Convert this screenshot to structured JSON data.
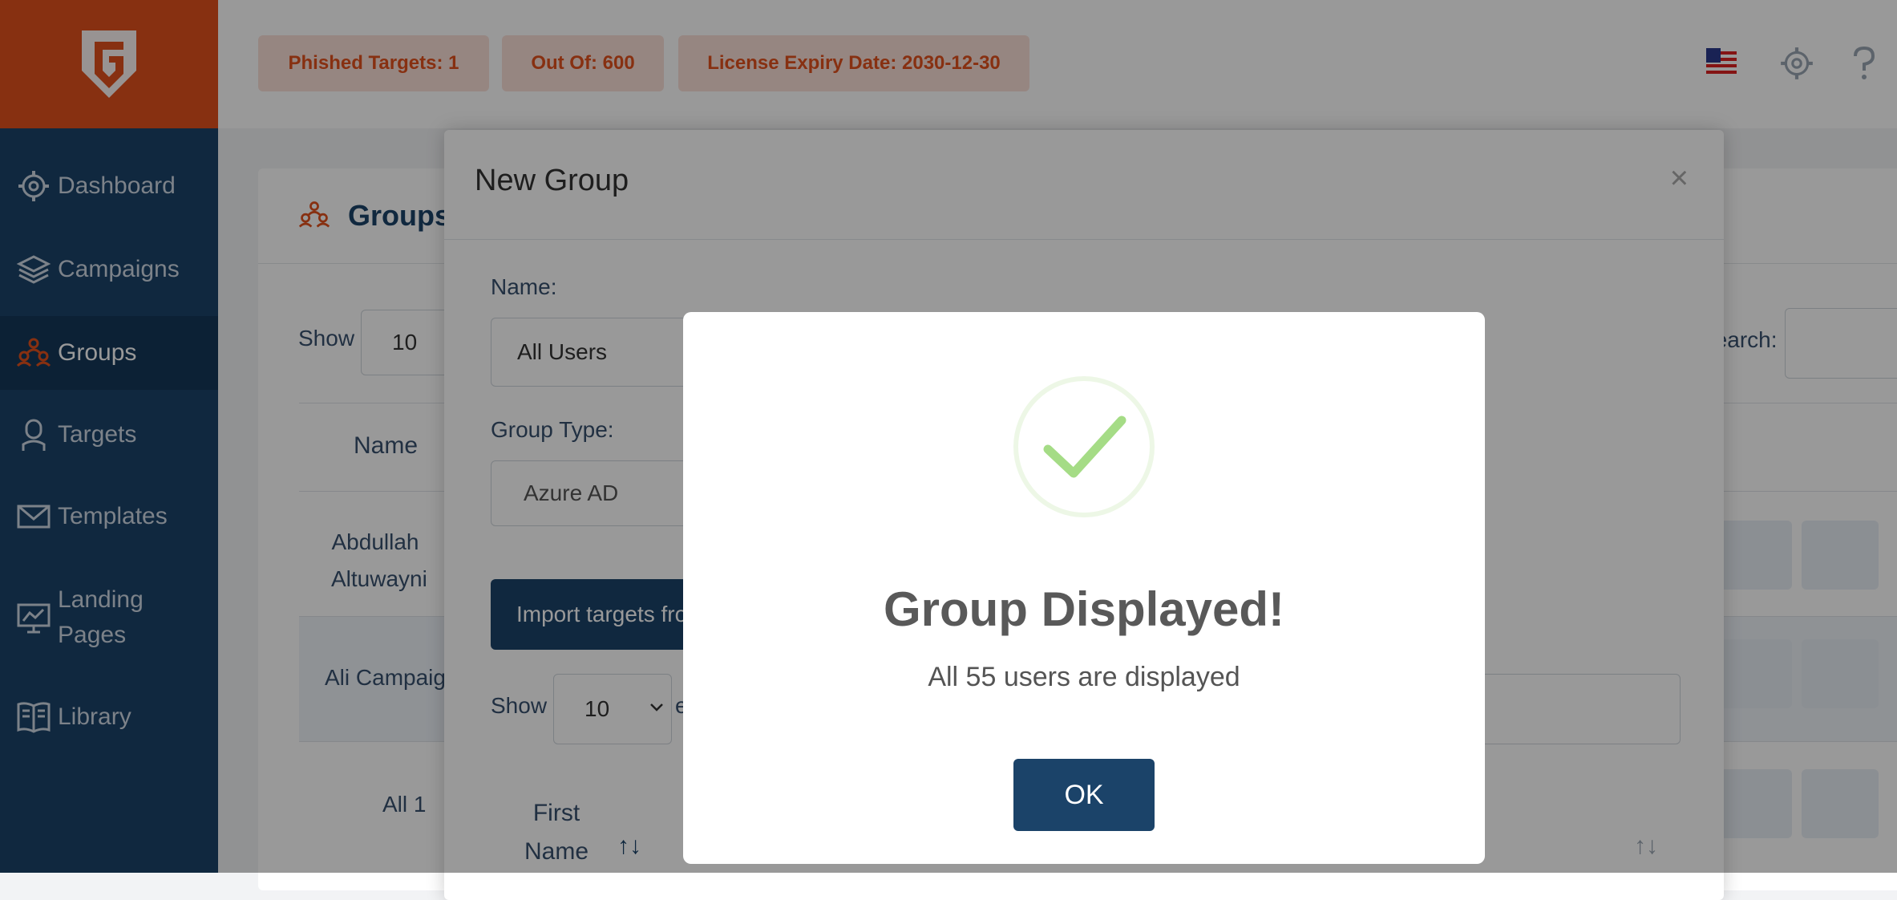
{
  "topbar": {
    "phished_label": "Phished Targets:",
    "phished_value": "1",
    "outof_label": "Out Of:",
    "outof_value": "600",
    "license_label": "License Expiry Date:",
    "license_value": "2030-12-30"
  },
  "sidebar": {
    "items": [
      {
        "label": "Dashboard",
        "icon": "gear-icon"
      },
      {
        "label": "Campaigns",
        "icon": "layers-icon"
      },
      {
        "label": "Groups",
        "icon": "users-icon"
      },
      {
        "label": "Targets",
        "icon": "person-icon"
      },
      {
        "label": "Templates",
        "icon": "envelope-icon"
      },
      {
        "label": "Landing\nPages",
        "icon": "chart-monitor-icon"
      },
      {
        "label": "Library",
        "icon": "book-icon"
      }
    ],
    "active": "Groups"
  },
  "groups_page": {
    "title": "Groups",
    "show_label": "Show",
    "show_value": "10",
    "search_label": "Search:",
    "column_name": "Name",
    "rows": [
      "Abdullah Altuwayni",
      "Ali Campaign",
      "All 1"
    ]
  },
  "modal": {
    "title": "New Group",
    "close": "×",
    "name_label": "Name:",
    "name_value": "All Users",
    "type_label": "Group Type:",
    "type_value": "Azure AD",
    "import_button": "Import targets from",
    "show_label": "Show",
    "show_value": "10",
    "entries_label": "e",
    "col_first_name": "First\nName"
  },
  "alert": {
    "title": "Group Displayed!",
    "message": "All 55 users are displayed",
    "ok_label": "OK"
  },
  "colors": {
    "brand_orange": "#e2511d",
    "navy": "#1b4369",
    "success_green": "#a5dc86"
  }
}
